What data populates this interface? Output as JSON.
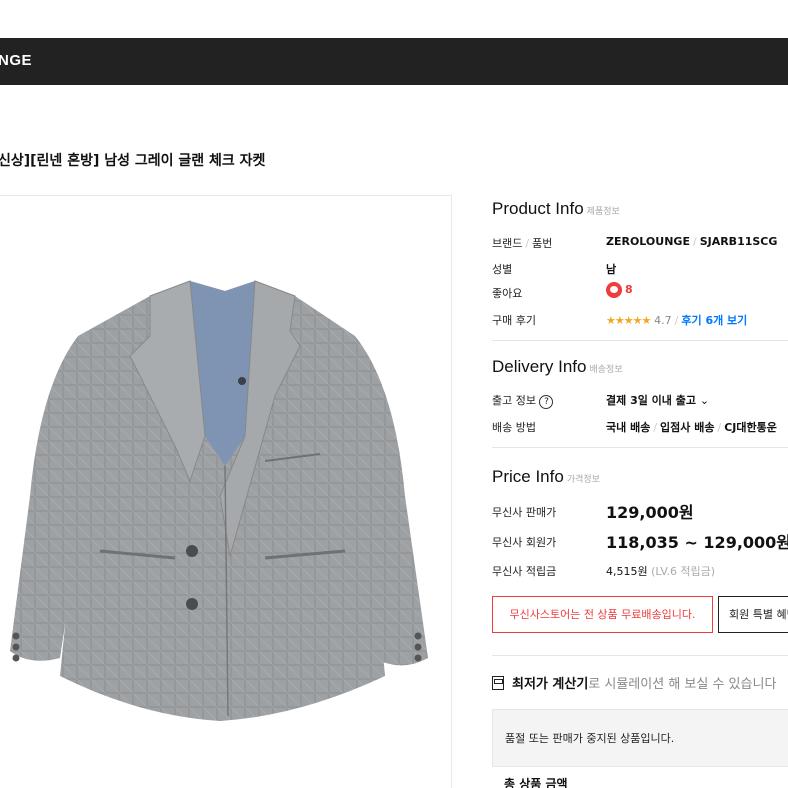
{
  "header": {
    "logo_text": "NGE"
  },
  "product": {
    "title": "신상][린넨 혼방] 남성 그레이 글랜 체크 자켓"
  },
  "product_info": {
    "title": "Product Info",
    "subtitle": "제품정보",
    "brand_label": "브랜드 / 품번",
    "brand_label_a": "브랜드",
    "brand_label_b": "품번",
    "brand_value": "ZEROLOUNGE",
    "sku_value": "SJARB11SCG",
    "gender_label": "성별",
    "gender_value": "남",
    "likes_label": "좋아요",
    "likes_count": "8",
    "reviews_label": "구매 후기",
    "stars": "★★★★★",
    "rating": "4.7",
    "reviews_link": "후기 6개 보기"
  },
  "delivery_info": {
    "title": "Delivery Info",
    "subtitle": "배송정보",
    "shipping_label": "출고 정보",
    "shipping_value": "결제 3일 이내 출고",
    "method_label": "배송 방법",
    "method_1": "국내 배송",
    "method_2": "입점사 배송",
    "method_3": "CJ대한통운"
  },
  "price_info": {
    "title": "Price Info",
    "subtitle": "가격정보",
    "sale_label": "무신사 판매가",
    "sale_value": "129,000원",
    "member_label": "무신사 회원가",
    "member_value": "118,035 ~ 129,000원",
    "points_label": "무신사 적립금",
    "points_value": "4,515원",
    "points_level": "(LV.6 적립금)"
  },
  "promo": {
    "free_shipping": "무신사스토어는 전 상품 무료배송입니다.",
    "member_benefit": "회원 특별 혜택"
  },
  "calculator": {
    "strong": "최저가 계산기",
    "rest": "로 시뮬레이션 해 보실 수 있습니다"
  },
  "status": {
    "soldout_text": "품절 또는 판매가 중지된 상품입니다.",
    "total_label": "총 상품 금액"
  },
  "colors": {
    "header_bg": "#222222",
    "accent_red": "#f03c3c",
    "link_blue": "#0078ff",
    "star_gold": "#f5a623"
  }
}
